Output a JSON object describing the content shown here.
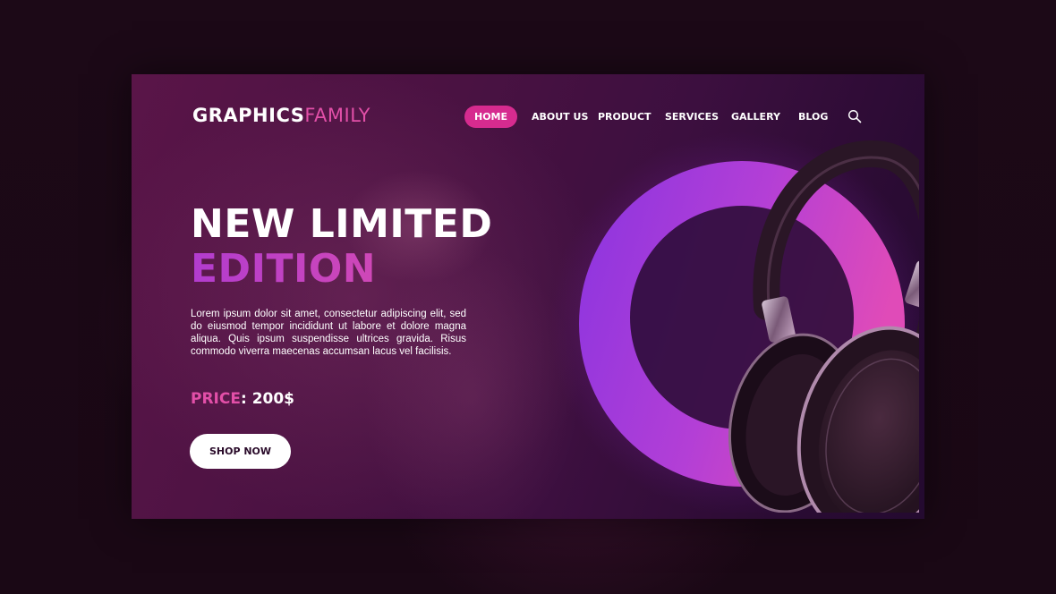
{
  "logo": {
    "part1": "GRAPHICS",
    "part2": "FAMILY"
  },
  "nav": {
    "items": [
      {
        "label": "HOME",
        "active": true
      },
      {
        "label": "ABOUT US",
        "active": false
      },
      {
        "label": "PRODUCT",
        "active": false
      },
      {
        "label": "SERVICES",
        "active": false
      },
      {
        "label": "GALLERY",
        "active": false
      },
      {
        "label": "BLOG",
        "active": false
      }
    ],
    "search_icon": "search-icon"
  },
  "hero": {
    "headline_line1": "NEW LIMITED",
    "headline_line2": "EDITION",
    "description": "Lorem ipsum dolor sit amet, consectetur adipiscing elit, sed do eiusmod tempor incididunt ut labore et dolore magna aliqua. Quis ipsum suspendisse ultrices gravida. Risus commodo viverra maecenas accumsan lacus vel facilisis.",
    "price_label": "PRICE",
    "price_separator": ": ",
    "price_value": "200$",
    "cta_label": "SHOP NOW"
  },
  "product": {
    "icon": "headphones-image"
  },
  "colors": {
    "accent": "#e24fa8",
    "nav_active": "#d62b8f",
    "gradient_purple": "#b23ccf",
    "card_bg": "#4a1242",
    "page_bg": "#1a0816"
  }
}
